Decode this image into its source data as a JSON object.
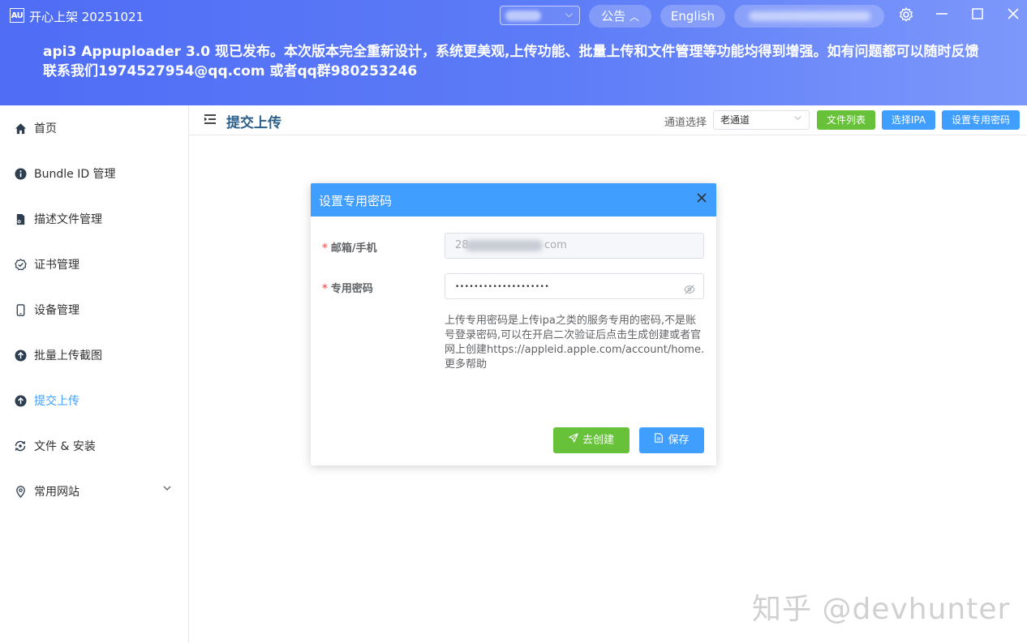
{
  "titlebar": {
    "logo": "AU",
    "app_title": "开心上架 20251021",
    "notice_label": "公告",
    "language_label": "English",
    "icons": [
      "settings-icon",
      "minimize-icon",
      "maximize-icon",
      "close-icon"
    ]
  },
  "banner": {
    "text": "api3 Appuploader 3.0 现已发布。本次版本完全重新设计，系统更美观,上传功能、批量上传和文件管理等功能均得到增强。如有问题都可以随时反馈联系我们1974527954@qq.com 或者qq群980253246"
  },
  "sidebar": {
    "items": [
      {
        "label": "首页",
        "icon": "home-icon"
      },
      {
        "label": "Bundle ID 管理",
        "icon": "info-circle-icon"
      },
      {
        "label": "描述文件管理",
        "icon": "document-icon"
      },
      {
        "label": "证书管理",
        "icon": "certificate-check-icon"
      },
      {
        "label": "设备管理",
        "icon": "phone-icon"
      },
      {
        "label": "批量上传截图",
        "icon": "upload-circle-icon"
      },
      {
        "label": "提交上传",
        "icon": "upload-circle-icon",
        "active": true
      },
      {
        "label": "文件 & 安装",
        "icon": "sync-icon"
      },
      {
        "label": "常用网站",
        "icon": "location-icon",
        "expandable": true
      }
    ]
  },
  "header": {
    "title": "提交上传",
    "channel_label": "通道选择",
    "channel_value": "老通道",
    "btn_files": "文件列表",
    "btn_select_ipa": "选择IPA",
    "btn_set_password": "设置专用密码"
  },
  "modal": {
    "title": "设置专用密码",
    "email_label": "邮箱/手机",
    "email_prefix": "28",
    "email_suffix": "com",
    "password_label": "专用密码",
    "password_value": "••••••••••••••••••••",
    "help_text": "上传专用密码是上传ipa之类的服务专用的密码,不是账号登录密码,可以在开启二次验证后点击生成创建或者官网上创建https://appleid.apple.com/account/home.更多帮助",
    "btn_create": "去创建",
    "btn_save": "保存"
  },
  "watermark": "知乎 @devhunter",
  "colors": {
    "primary": "#409eff",
    "success": "#67c23a",
    "banner_start": "#4f6df5",
    "banner_end": "#7d98fb",
    "required": "#f56c6c"
  }
}
